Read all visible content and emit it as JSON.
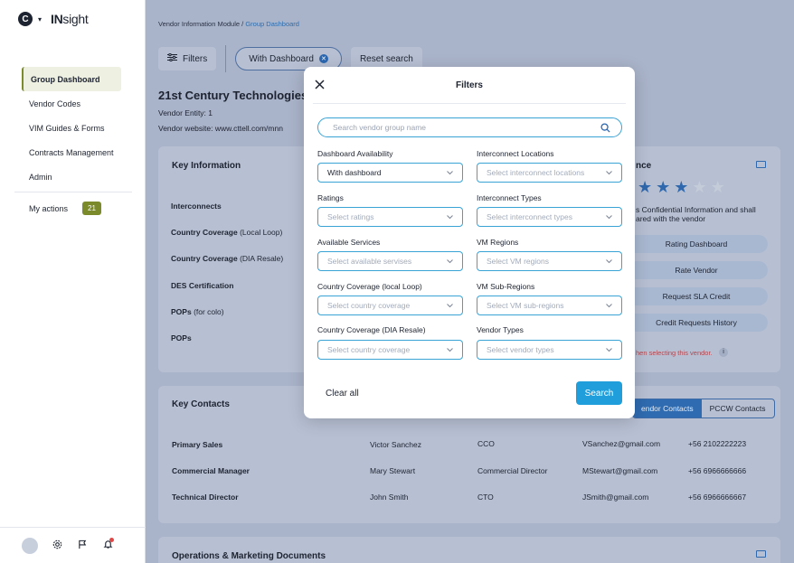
{
  "app": {
    "logo_letter": "C",
    "logo_bold": "IN",
    "logo_rest": "sight"
  },
  "sidebar": {
    "items": [
      {
        "label": "Group Dashboard"
      },
      {
        "label": "Vendor Codes"
      },
      {
        "label": "VIM Guides & Forms"
      },
      {
        "label": "Contracts Management"
      },
      {
        "label": "Admin"
      }
    ],
    "my_actions": {
      "label": "My actions",
      "count": "21"
    }
  },
  "breadcrumb": {
    "parent": "Vendor Information Module",
    "separator": "/",
    "current": "Group Dashboard"
  },
  "toolbar": {
    "filters": "Filters",
    "with_dashboard": "With Dashboard",
    "reset": "Reset search"
  },
  "vendor": {
    "name": "21st Century Technologies",
    "entity": "Vendor Entity: 1",
    "website": "Vendor website: www.cttell.com/mnn"
  },
  "key_info": {
    "title": "Key Information",
    "rows": [
      {
        "label": "Interconnects",
        "suffix": ""
      },
      {
        "label": "Country Coverage",
        "suffix": "(Local Loop)"
      },
      {
        "label": "Country Coverage",
        "suffix": "(DIA Resale)"
      },
      {
        "label": "DES Certification",
        "suffix": ""
      },
      {
        "label": "POPs",
        "suffix": "(for colo)"
      },
      {
        "label": "POPs",
        "suffix": ""
      }
    ]
  },
  "rating_card": {
    "title_fragment": "nce",
    "rating": 3,
    "max_rating": 5,
    "note_line1": "s Confidential Information and shall",
    "note_line2": "ared with the vendor",
    "buttons": [
      "Rating Dashboard",
      "Rate Vendor",
      "Request SLA Credit",
      "Credit Requests History"
    ],
    "warning": "hen selecting this vendor.",
    "info_glyph": "i"
  },
  "contacts": {
    "title": "Key Contacts",
    "tabs": [
      "endor Contacts",
      "PCCW Contacts"
    ],
    "rows": [
      {
        "role": "Primary Sales",
        "name": "Victor Sanchez",
        "title": "CCO",
        "email": "VSanchez@gmail.com",
        "phone": "+56 2102222223"
      },
      {
        "role": "Commercial Manager",
        "name": "Mary Stewart",
        "title": "Commercial Director",
        "email": "MStewart@gmail.com",
        "phone": "+56 6966666666"
      },
      {
        "role": "Technical Director",
        "name": "John Smith",
        "title": "CTO",
        "email": "JSmith@gmail.com",
        "phone": "+56 6966666667"
      }
    ]
  },
  "docs": {
    "title": "Operations & Marketing Documents"
  },
  "modal": {
    "title": "Filters",
    "search_placeholder": "Search vendor group name",
    "fields": [
      {
        "label": "Dashboard Availability",
        "value": "With dashboard"
      },
      {
        "label": "Interconnect Locations",
        "value": "Select interconnect locations"
      },
      {
        "label": "Ratings",
        "value": "Select ratings"
      },
      {
        "label": "Interconnect Types",
        "value": "Select interconnect types"
      },
      {
        "label": "Available Services",
        "value": "Select available servises"
      },
      {
        "label": "VM Regions",
        "value": "Select VM regions"
      },
      {
        "label": "Country Coverage (local Loop)",
        "value": "Select country coverage"
      },
      {
        "label": "VM Sub-Regions",
        "value": "Select VM sub-regions"
      },
      {
        "label": "Country Coverage (DIA Resale)",
        "value": "Select country coverage"
      },
      {
        "label": "Vendor Types",
        "value": "Select vendor types"
      }
    ],
    "clear_all": "Clear all",
    "search_button": "Search"
  },
  "colors": {
    "accent": "#1f9edb",
    "nav_active": "#7b8a2a",
    "star": "#2f68ad"
  }
}
